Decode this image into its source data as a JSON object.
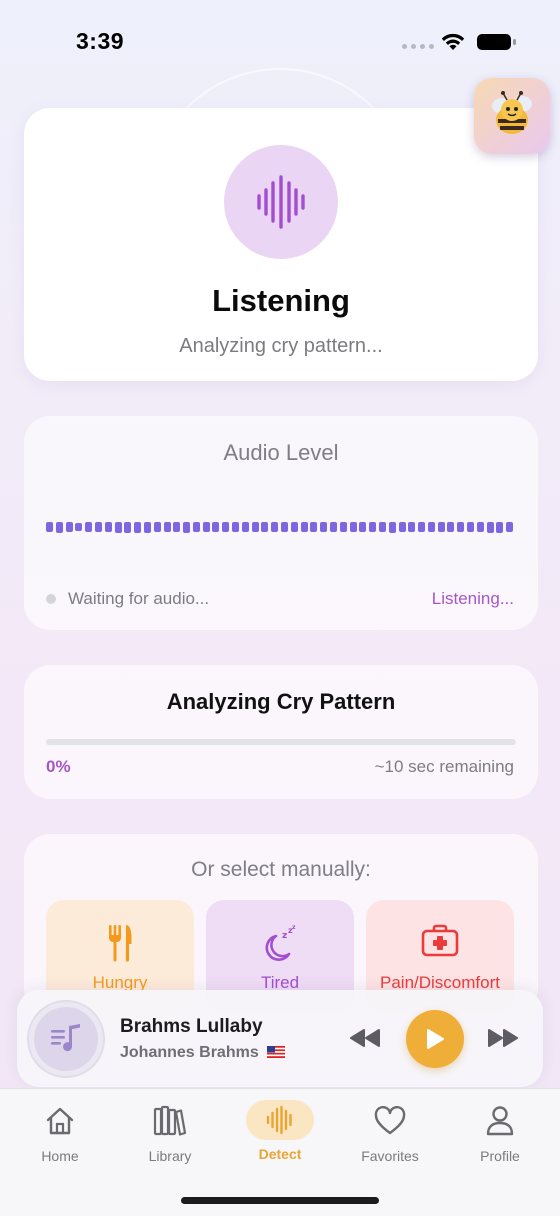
{
  "status_bar": {
    "time": "3:39"
  },
  "listening_card": {
    "title": "Listening",
    "subtitle": "Analyzing cry pattern...",
    "icon": "waveform-icon"
  },
  "audio_card": {
    "title": "Audio Level",
    "status_text": "Waiting for audio...",
    "state_text": "Listening...",
    "level_bars": [
      0.6,
      0.8,
      0.6,
      0.3,
      0.6,
      0.7,
      0.7,
      0.8,
      0.8,
      0.8,
      0.8,
      0.6,
      0.7,
      0.6,
      0.8,
      0.6,
      0.6,
      0.6,
      0.6,
      0.6,
      0.6,
      0.6,
      0.6,
      0.6,
      0.6,
      0.6,
      0.6,
      0.7,
      0.6,
      0.6,
      0.6,
      0.6,
      0.6,
      0.6,
      0.6,
      0.8,
      0.6,
      0.6,
      0.6,
      0.7,
      0.6,
      0.6,
      0.6,
      0.6,
      0.6,
      0.8,
      0.8,
      0.6
    ]
  },
  "analyze_card": {
    "title": "Analyzing Cry Pattern",
    "progress": 0,
    "progress_label": "0%",
    "remaining": "~10 sec remaining"
  },
  "manual_card": {
    "title": "Or select manually:",
    "options": [
      {
        "label": "Hungry",
        "icon": "utensils-icon",
        "color": "#f39a1e"
      },
      {
        "label": "Tired",
        "icon": "moon-sleep-icon",
        "color": "#a24fcf"
      },
      {
        "label": "Pain/Discomfort",
        "icon": "first-aid-icon",
        "color": "#ea3b3b"
      }
    ]
  },
  "player": {
    "title": "Brahms Lullaby",
    "artist": "Johannes Brahms",
    "accent": "#efae37"
  },
  "tabs": [
    {
      "label": "Home",
      "icon": "home-icon"
    },
    {
      "label": "Library",
      "icon": "books-icon"
    },
    {
      "label": "Detect",
      "icon": "waveform-icon",
      "active": true
    },
    {
      "label": "Favorites",
      "icon": "heart-icon"
    },
    {
      "label": "Profile",
      "icon": "person-icon"
    }
  ]
}
